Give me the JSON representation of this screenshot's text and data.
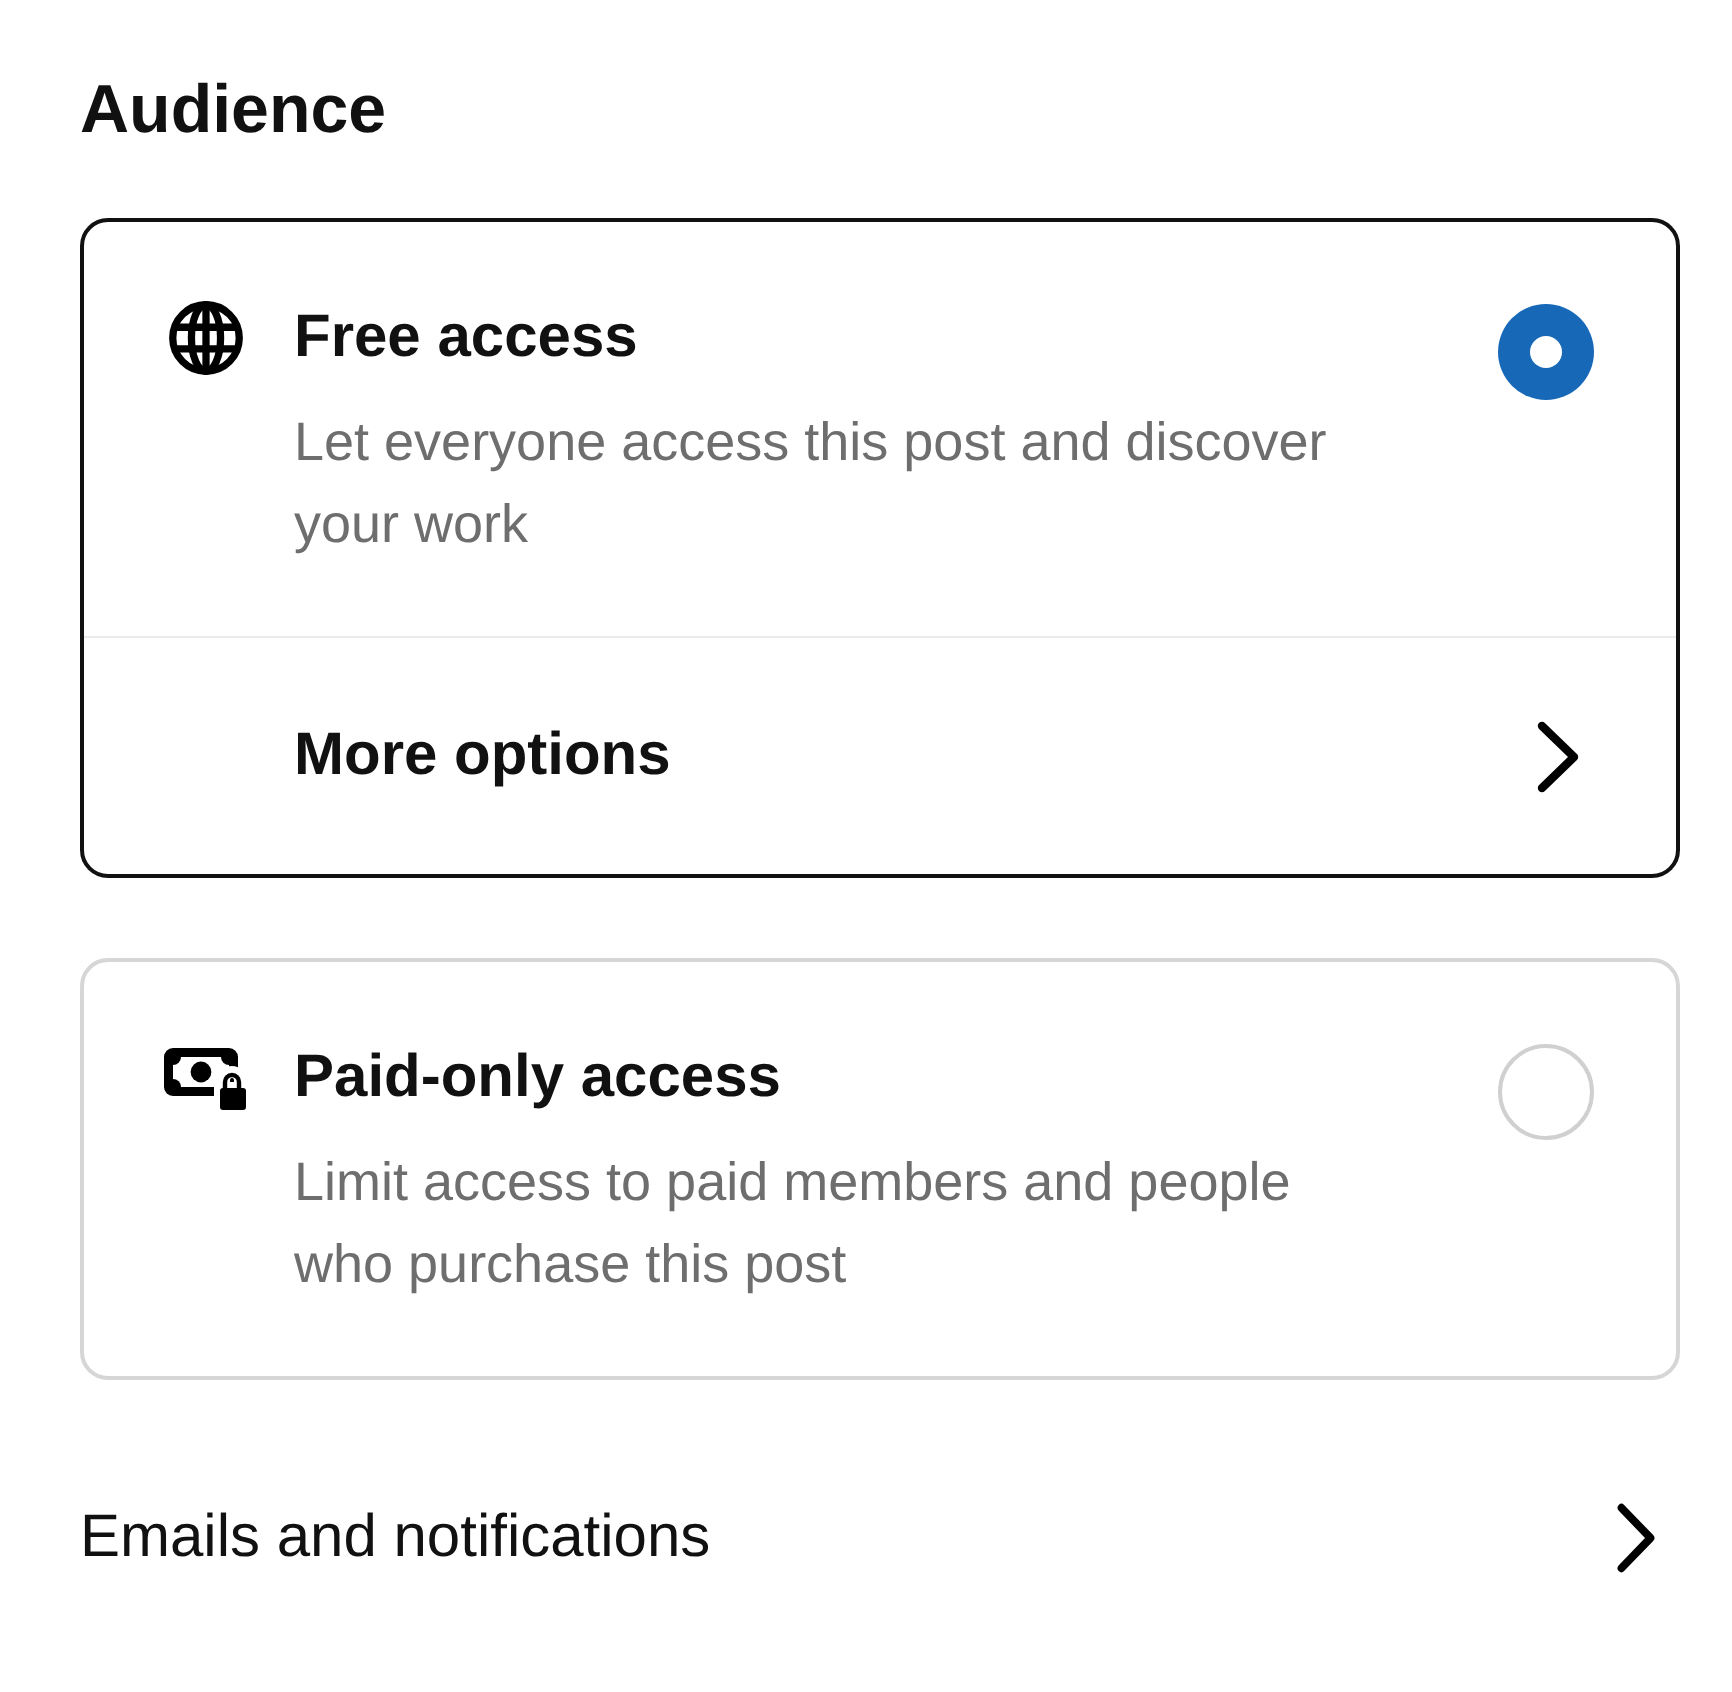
{
  "heading": "Audience",
  "options": [
    {
      "kind": "globe",
      "title": "Free access",
      "description": "Let everyone access this post and discover your work",
      "selected": true,
      "more": {
        "label": "More options"
      }
    },
    {
      "kind": "money-lock",
      "title": "Paid-only access",
      "description": "Limit access to paid members and people who purchase this post",
      "selected": false
    }
  ],
  "link": {
    "label": "Emails and notifications"
  }
}
